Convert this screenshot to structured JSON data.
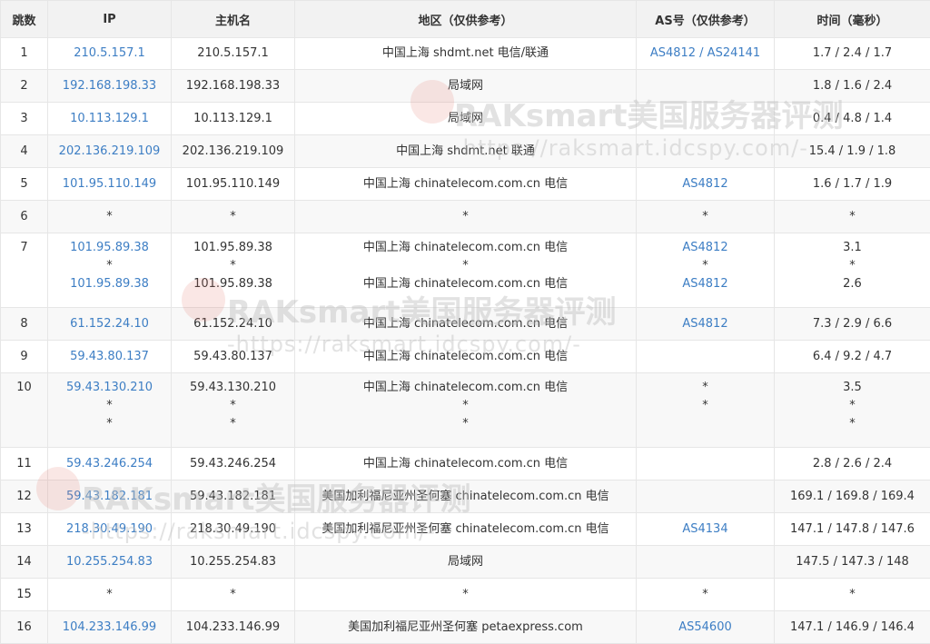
{
  "headers": [
    "跳数",
    "IP",
    "主机名",
    "地区（仅供参考）",
    "AS号（仅供参考）",
    "时间（毫秒）"
  ],
  "rows": [
    {
      "hop": "1",
      "ip": [
        "210.5.157.1"
      ],
      "host": [
        "210.5.157.1"
      ],
      "region": [
        "中国上海 shdmt.net 电信/联通"
      ],
      "as": [
        "AS4812 / AS24141"
      ],
      "time": [
        "1.7 / 2.4 / 1.7"
      ]
    },
    {
      "hop": "2",
      "ip": [
        "192.168.198.33"
      ],
      "host": [
        "192.168.198.33"
      ],
      "region": [
        "局域网"
      ],
      "as": [
        ""
      ],
      "time": [
        "1.8 / 1.6 / 2.4"
      ]
    },
    {
      "hop": "3",
      "ip": [
        "10.113.129.1"
      ],
      "host": [
        "10.113.129.1"
      ],
      "region": [
        "局域网"
      ],
      "as": [
        ""
      ],
      "time": [
        "0.4 / 4.8 / 1.4"
      ]
    },
    {
      "hop": "4",
      "ip": [
        "202.136.219.109"
      ],
      "host": [
        "202.136.219.109"
      ],
      "region": [
        "中国上海 shdmt.net 联通"
      ],
      "as": [
        ""
      ],
      "time": [
        "15.4 / 1.9 / 1.8"
      ]
    },
    {
      "hop": "5",
      "ip": [
        "101.95.110.149"
      ],
      "host": [
        "101.95.110.149"
      ],
      "region": [
        "中国上海 chinatelecom.com.cn 电信"
      ],
      "as": [
        "AS4812"
      ],
      "time": [
        "1.6 / 1.7 / 1.9"
      ]
    },
    {
      "hop": "6",
      "ip": [
        "*"
      ],
      "host": [
        "*"
      ],
      "region": [
        "*"
      ],
      "as": [
        "*"
      ],
      "time": [
        "*"
      ]
    },
    {
      "hop": "7",
      "ip": [
        "101.95.89.38",
        "*",
        "101.95.89.38"
      ],
      "host": [
        "101.95.89.38",
        "*",
        "101.95.89.38"
      ],
      "region": [
        "中国上海 chinatelecom.com.cn 电信",
        "*",
        "中国上海 chinatelecom.com.cn 电信"
      ],
      "as": [
        "AS4812",
        "*",
        "AS4812"
      ],
      "time": [
        "3.1",
        "*",
        "2.6"
      ]
    },
    {
      "hop": "8",
      "ip": [
        "61.152.24.10"
      ],
      "host": [
        "61.152.24.10"
      ],
      "region": [
        "中国上海 chinatelecom.com.cn 电信"
      ],
      "as": [
        "AS4812"
      ],
      "time": [
        "7.3 / 2.9 / 6.6"
      ]
    },
    {
      "hop": "9",
      "ip": [
        "59.43.80.137"
      ],
      "host": [
        "59.43.80.137"
      ],
      "region": [
        "中国上海 chinatelecom.com.cn 电信"
      ],
      "as": [
        ""
      ],
      "time": [
        "6.4 / 9.2 / 4.7"
      ]
    },
    {
      "hop": "10",
      "ip": [
        "59.43.130.210",
        "*",
        "*"
      ],
      "host": [
        "59.43.130.210",
        "*",
        "*"
      ],
      "region": [
        "中国上海 chinatelecom.com.cn 电信",
        "*",
        "*"
      ],
      "as": [
        "",
        "*",
        "*"
      ],
      "time": [
        "3.5",
        "*",
        "*"
      ]
    },
    {
      "hop": "11",
      "ip": [
        "59.43.246.254"
      ],
      "host": [
        "59.43.246.254"
      ],
      "region": [
        "中国上海 chinatelecom.com.cn 电信"
      ],
      "as": [
        ""
      ],
      "time": [
        "2.8 / 2.6 / 2.4"
      ]
    },
    {
      "hop": "12",
      "ip": [
        "59.43.182.181"
      ],
      "host": [
        "59.43.182.181"
      ],
      "region": [
        "美国加利福尼亚州圣何塞 chinatelecom.com.cn 电信"
      ],
      "as": [
        ""
      ],
      "time": [
        "169.1 / 169.8 / 169.4"
      ]
    },
    {
      "hop": "13",
      "ip": [
        "218.30.49.190"
      ],
      "host": [
        "218.30.49.190"
      ],
      "region": [
        "美国加利福尼亚州圣何塞 chinatelecom.com.cn 电信"
      ],
      "as": [
        "AS4134"
      ],
      "time": [
        "147.1 / 147.8 / 147.6"
      ]
    },
    {
      "hop": "14",
      "ip": [
        "10.255.254.83"
      ],
      "host": [
        "10.255.254.83"
      ],
      "region": [
        "局域网"
      ],
      "as": [
        ""
      ],
      "time": [
        "147.5 / 147.3 / 148"
      ]
    },
    {
      "hop": "15",
      "ip": [
        "*"
      ],
      "host": [
        "*"
      ],
      "region": [
        "*"
      ],
      "as": [
        "*"
      ],
      "time": [
        "*"
      ]
    },
    {
      "hop": "16",
      "ip": [
        "104.233.146.99"
      ],
      "host": [
        "104.233.146.99"
      ],
      "region": [
        "美国加利福尼亚州圣何塞 petaexpress.com"
      ],
      "as": [
        "AS54600"
      ],
      "time": [
        "147.1 / 146.9 / 146.4"
      ]
    }
  ],
  "watermark": {
    "title": "RAKsmart美国服务器评测",
    "url": "-https://raksmart.idcspy.com/-"
  },
  "colors": {
    "link": "#3d7ec4",
    "header_bg": "#f2f2f2",
    "alt_row_bg": "#f8f8f8",
    "border": "#e6e6e6"
  }
}
